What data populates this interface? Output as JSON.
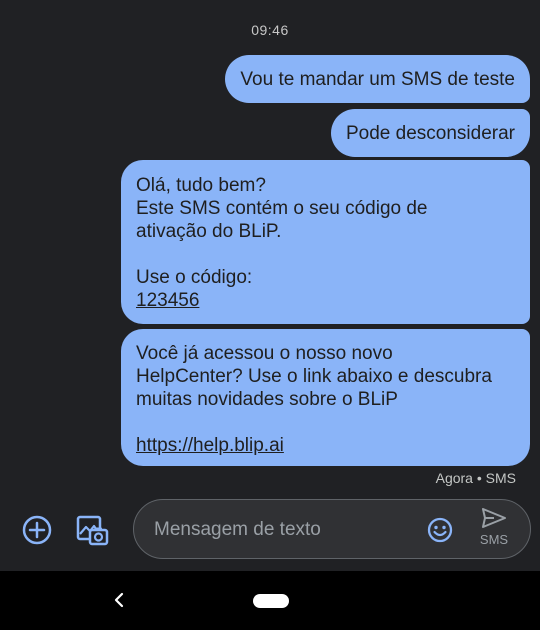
{
  "status": {
    "time": "09:46"
  },
  "messages": [
    {
      "lines": [
        "Vou te mandar um SMS de teste"
      ]
    },
    {
      "lines": [
        "Pode desconsiderar"
      ]
    },
    {
      "lines": [
        "Olá, tudo bem?",
        "Este SMS contém o seu código de",
        "ativação do BLiP.",
        "",
        "Use o código:"
      ],
      "link": "123456"
    },
    {
      "lines": [
        "Você já acessou o nosso novo",
        "HelpCenter? Use o link abaixo e descubra",
        "muitas novidades sobre o BLiP",
        ""
      ],
      "link": "https://help.blip.ai"
    }
  ],
  "message_meta": "Agora • SMS",
  "composer": {
    "placeholder": "Mensagem de texto",
    "send_label": "SMS"
  },
  "colors": {
    "bubble": "#8ab4f8",
    "background": "#202124",
    "accent": "#8ab4f8"
  },
  "icons": {
    "add": "add-circle-icon",
    "gallery": "gallery-icon",
    "emoji": "emoji-icon",
    "send": "send-icon",
    "back": "back-chevron-icon"
  }
}
